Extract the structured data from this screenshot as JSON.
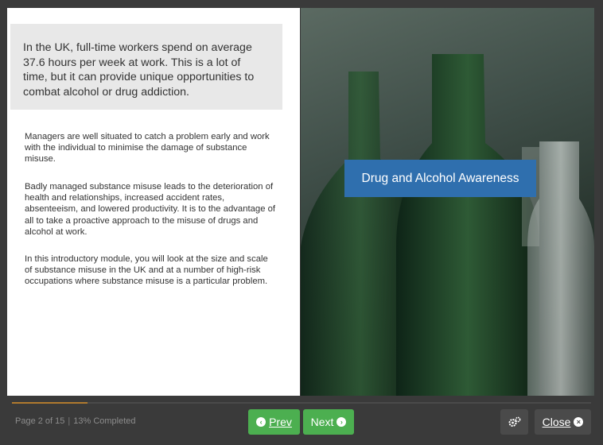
{
  "left_panel": {
    "intro": "In the UK, full-time workers spend on average 37.6 hours per week at work. This is a lot of time, but it can provide unique opportunities to combat alcohol or drug addiction.",
    "paragraphs": [
      "Managers are well situated to catch a problem early and work with the individual to minimise the damage of substance misuse.",
      "Badly managed substance misuse leads to the deterioration of health and relationships, increased accident rates, absenteeism, and lowered productivity. It is to the advantage of all to take a proactive approach to the misuse of drugs and alcohol at work.",
      "In this introductory module, you will look at the size and scale of substance misuse in the UK and at a number of high-risk occupations where substance misuse is a particular problem."
    ]
  },
  "right_panel": {
    "title": "Drug and Alcohol Awareness"
  },
  "footer": {
    "page_label": "Page 2 of 15",
    "separator": "|",
    "completed_label": "13% Completed",
    "progress_fraction": 0.13,
    "prev_label": "Prev",
    "next_label": "Next",
    "close_label": "Close",
    "prev_icon": "chevron-left-circle-icon",
    "next_icon": "chevron-right-circle-icon",
    "settings_icon": "gears-icon",
    "close_icon": "close-circle-icon"
  },
  "colors": {
    "primary_button": "#4caf50",
    "banner": "#2f6fae",
    "progress": "#b07a2e",
    "background": "#3a3a3a"
  }
}
